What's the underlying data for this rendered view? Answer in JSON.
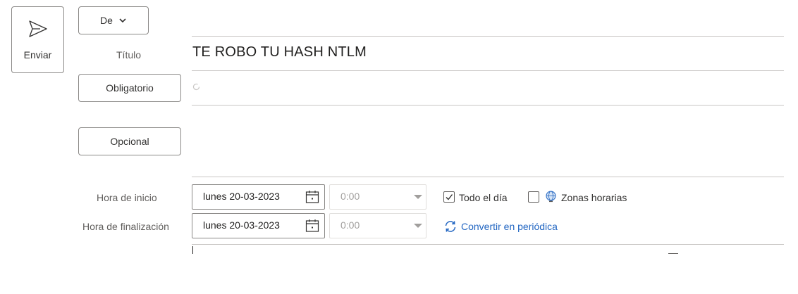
{
  "toolbar": {
    "send_label": "Enviar"
  },
  "from": {
    "label": "De"
  },
  "title": {
    "label": "Título",
    "value": "TE ROBO TU HASH NTLM"
  },
  "attendees": {
    "required_label": "Obligatorio",
    "optional_label": "Opcional"
  },
  "start": {
    "label": "Hora de inicio",
    "date": "lunes 20-03-2023",
    "time": "0:00"
  },
  "end": {
    "label": "Hora de finalización",
    "date": "lunes 20-03-2023",
    "time": "0:00"
  },
  "options": {
    "all_day_label": "Todo el día",
    "all_day_checked": true,
    "time_zones_label": "Zonas horarias",
    "time_zones_checked": false,
    "recurring_label": "Convertir en periódica"
  },
  "colors": {
    "accent": "#2266c2",
    "border": "#8a8886",
    "muted_text": "#605e5c"
  }
}
